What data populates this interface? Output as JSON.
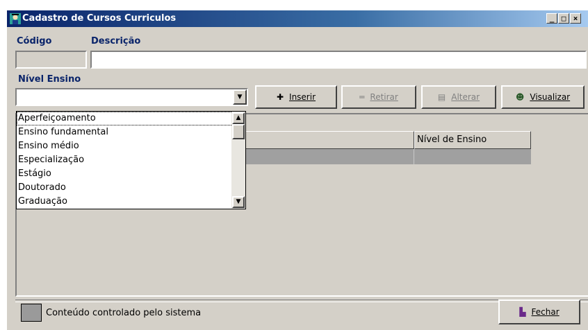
{
  "window": {
    "title": "Cadastro de Cursos Curriculos",
    "controls": [
      "_",
      "□",
      "×"
    ]
  },
  "form": {
    "codigo_label": "Código",
    "descricao_label": "Descrição",
    "codigo_value": "",
    "descricao_value": "",
    "nivel_label": "Nível Ensino",
    "nivel_value": ""
  },
  "dropdown": {
    "options": [
      "Aperfeiçoamento",
      "Ensino fundamental",
      "Ensino médio",
      "Especialização",
      "Estágio",
      "Doutorado",
      "Graduação"
    ],
    "focused_index": 0
  },
  "toolbar": {
    "inserir": "Inserir",
    "retirar": "Retirar",
    "alterar": "Alterar",
    "visualizar": "Visualizar"
  },
  "grid": {
    "columns": [
      "Nível de Ensino"
    ]
  },
  "footer": {
    "legend_text": "Conteúdo controlado pelo sistema",
    "legend_color": "#9a9a9a",
    "fechar": "Fechar"
  },
  "colors": {
    "title_start": "#0a246a",
    "title_end": "#a6caf0",
    "face": "#d4d0c8",
    "selected_row": "#a0a0a0"
  }
}
